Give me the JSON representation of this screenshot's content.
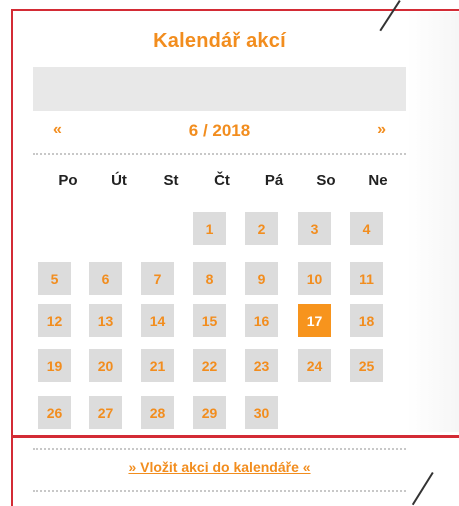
{
  "calendar": {
    "title": "Kalendář akcí",
    "nav": {
      "prev": "«",
      "month_label": "6 / 2018",
      "next": "»"
    },
    "weekdays": [
      "Po",
      "Út",
      "St",
      "Čt",
      "Pá",
      "So",
      "Ne"
    ],
    "weeks": [
      [
        "",
        "",
        "",
        "1",
        "2",
        "3",
        "4"
      ],
      [
        "5",
        "6",
        "7",
        "8",
        "9",
        "10",
        "11"
      ],
      [
        "12",
        "13",
        "14",
        "15",
        "16",
        "17",
        "18"
      ],
      [
        "19",
        "20",
        "21",
        "22",
        "23",
        "24",
        "25"
      ],
      [
        "26",
        "27",
        "28",
        "29",
        "30",
        "",
        ""
      ]
    ],
    "selected_day": "17",
    "insert_link": "» Vložit akci do kalendáře «"
  },
  "colors": {
    "accent": "#f28d1e",
    "today_bg": "#f7941d",
    "cell_bg": "#dcdcdc",
    "frame": "#d32b35"
  }
}
